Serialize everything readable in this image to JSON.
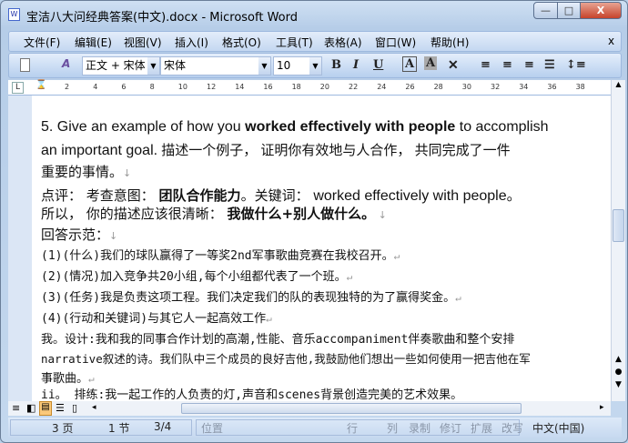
{
  "window": {
    "title": "宝洁八大问经典答案(中文).docx - Microsoft Word",
    "min": "—",
    "max": "□",
    "close": "X"
  },
  "menu": [
    "文件(F)",
    "编辑(E)",
    "视图(V)",
    "插入(I)",
    "格式(O)",
    "工具(T)",
    "表格(A)",
    "窗口(W)",
    "帮助(H)"
  ],
  "menu_close": "x",
  "toolbar": {
    "style": "正文 + 宋体",
    "font": "宋体",
    "size": "10",
    "bold": "B",
    "italic": "I",
    "underline": "U",
    "border_a": "A",
    "shade_a": "A"
  },
  "ruler": [
    "2",
    "4",
    "6",
    "8",
    "10",
    "12",
    "14",
    "16",
    "18",
    "20",
    "22",
    "24",
    "26",
    "28",
    "30",
    "32",
    "34",
    "36",
    "38"
  ],
  "doc": {
    "q_prefix": "5. Give an example of how you ",
    "q_bold": "worked effectively with people",
    "q_suffix": " to accomplish",
    "q_line2_en": "an important goal.",
    "q_line2_cn": "  描述一个例子，  证明你有效地与人合作，  共同完成了一件",
    "q_line3": "重要的事情。",
    "c1a": "点评：  考查意图：  ",
    "c1b": "团队合作能力",
    "c1c": "。关键词：  ",
    "c1d": "worked effectively with people。",
    "c2a": "所以，  你的描述应该很清晰：  ",
    "c2b": "我做什么+别人做什么。",
    "c3": "回答示范：",
    "a1": "(1)(什么)我们的球队赢得了一等奖2nd军事歌曲竞赛在我校召开。",
    "a2": "(2)(情况)加入竞争共20小组,每个小组都代表了一个班。",
    "a3": "(3)(任务)我是负责这项工程。我们决定我们的队的表现独特的为了赢得奖金。",
    "a4": "(4)(行动和关键词)与其它人一起高效工作",
    "a5": "我。设计:我和我的同事合作计划的高潮,性能、音乐accompaniment伴奏歌曲和整个安排",
    "a6": "narrative叙述的诗。我们队中三个成员的良好吉他,我鼓励他们想出一些如何使用一把吉他在军",
    "a7": "事歌曲。",
    "a8": "ii。 排练:我一起工作的人负责的灯,声音和scenes背景创造完美的艺术效果。"
  },
  "status": {
    "page": "3 页",
    "section": "1 节",
    "pages": "3/4",
    "position": "位置",
    "row": "行",
    "col": "列",
    "rec": "录制",
    "trk": "修订",
    "ext": "扩展",
    "ovr": "改写",
    "lang": "中文(中国)"
  }
}
